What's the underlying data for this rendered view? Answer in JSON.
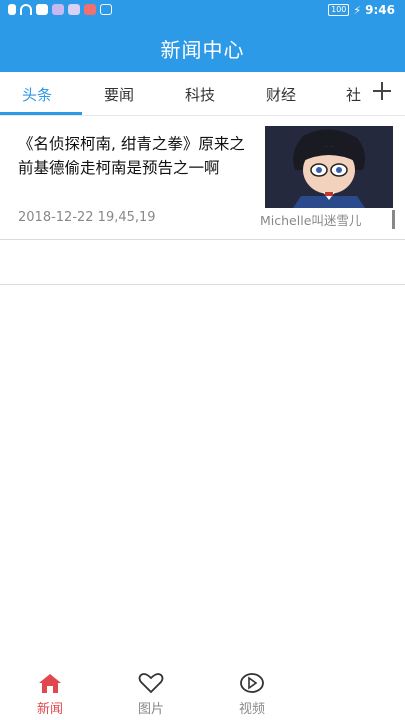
{
  "status_bar": {
    "battery": "100",
    "time": "9:46"
  },
  "header": {
    "title": "新闻中心"
  },
  "tabs": [
    {
      "label": "头条"
    },
    {
      "label": "要闻"
    },
    {
      "label": "科技"
    },
    {
      "label": "财经"
    },
    {
      "label": "社"
    }
  ],
  "news": [
    {
      "title": "《名侦探柯南, 绀青之拳》原来之前基德偷走柯南是预告之一啊",
      "date": "2018-12-22 19,45,19",
      "author": "Michelle叫迷雪儿"
    }
  ],
  "bottom_nav": [
    {
      "label": "新闻",
      "icon": "home-icon"
    },
    {
      "label": "图片",
      "icon": "heart-icon"
    },
    {
      "label": "视频",
      "icon": "play-icon"
    }
  ],
  "colors": {
    "accent": "#2d9ae8",
    "nav_active": "#e0484d"
  }
}
